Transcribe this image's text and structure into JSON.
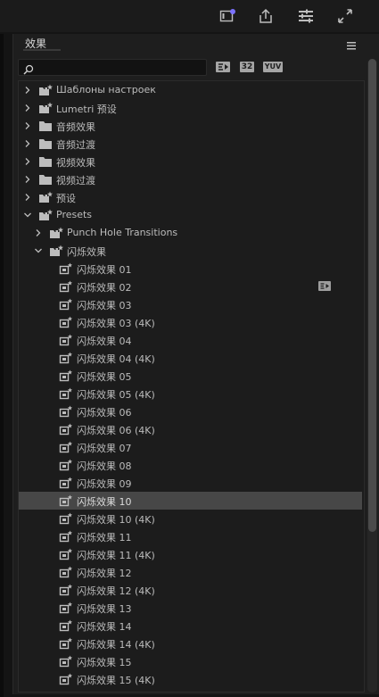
{
  "panel": {
    "title": "效果"
  },
  "search": {
    "value": "",
    "placeholder": ""
  },
  "filters": {
    "b32": "32",
    "yuv": "YUV"
  },
  "tree": [
    {
      "level": 0,
      "expanded": false,
      "icon": "preset-folder-icon",
      "label": "Шаблоны настроек"
    },
    {
      "level": 0,
      "expanded": false,
      "icon": "preset-folder-icon",
      "label": "Lumetri 预设"
    },
    {
      "level": 0,
      "expanded": false,
      "icon": "folder-icon",
      "label": "音频效果"
    },
    {
      "level": 0,
      "expanded": false,
      "icon": "folder-icon",
      "label": "音频过渡"
    },
    {
      "level": 0,
      "expanded": false,
      "icon": "folder-icon",
      "label": "视频效果"
    },
    {
      "level": 0,
      "expanded": false,
      "icon": "folder-icon",
      "label": "视频过渡"
    },
    {
      "level": 0,
      "expanded": false,
      "icon": "preset-folder-icon",
      "label": "预设"
    },
    {
      "level": 0,
      "expanded": true,
      "icon": "preset-folder-icon",
      "label": "Presets"
    },
    {
      "level": 1,
      "expanded": false,
      "icon": "preset-folder-icon",
      "label": "Punch Hole Transitions"
    },
    {
      "level": 1,
      "expanded": true,
      "icon": "preset-folder-icon",
      "label": "闪烁效果"
    },
    {
      "level": 2,
      "icon": "preset-icon",
      "label": "闪烁效果 01"
    },
    {
      "level": 2,
      "icon": "preset-icon",
      "label": "闪烁效果 02",
      "badge": "accelerated-effect-icon"
    },
    {
      "level": 2,
      "icon": "preset-icon",
      "label": "闪烁效果 03"
    },
    {
      "level": 2,
      "icon": "preset-icon",
      "label": "闪烁效果 03 (4K)"
    },
    {
      "level": 2,
      "icon": "preset-icon",
      "label": "闪烁效果 04"
    },
    {
      "level": 2,
      "icon": "preset-icon",
      "label": "闪烁效果 04 (4K)"
    },
    {
      "level": 2,
      "icon": "preset-icon",
      "label": "闪烁效果 05"
    },
    {
      "level": 2,
      "icon": "preset-icon",
      "label": "闪烁效果 05 (4K)"
    },
    {
      "level": 2,
      "icon": "preset-icon",
      "label": "闪烁效果 06"
    },
    {
      "level": 2,
      "icon": "preset-icon",
      "label": "闪烁效果 06 (4K)"
    },
    {
      "level": 2,
      "icon": "preset-icon",
      "label": "闪烁效果 07"
    },
    {
      "level": 2,
      "icon": "preset-icon",
      "label": "闪烁效果 08"
    },
    {
      "level": 2,
      "icon": "preset-icon",
      "label": "闪烁效果 09"
    },
    {
      "level": 2,
      "icon": "preset-icon",
      "label": "闪烁效果 10",
      "selected": true
    },
    {
      "level": 2,
      "icon": "preset-icon",
      "label": "闪烁效果 10 (4K)"
    },
    {
      "level": 2,
      "icon": "preset-icon",
      "label": "闪烁效果 11"
    },
    {
      "level": 2,
      "icon": "preset-icon",
      "label": "闪烁效果 11 (4K)"
    },
    {
      "level": 2,
      "icon": "preset-icon",
      "label": "闪烁效果 12"
    },
    {
      "level": 2,
      "icon": "preset-icon",
      "label": "闪烁效果 12 (4K)"
    },
    {
      "level": 2,
      "icon": "preset-icon",
      "label": "闪烁效果 13"
    },
    {
      "level": 2,
      "icon": "preset-icon",
      "label": "闪烁效果 14"
    },
    {
      "level": 2,
      "icon": "preset-icon",
      "label": "闪烁效果 14 (4K)"
    },
    {
      "level": 2,
      "icon": "preset-icon",
      "label": "闪烁效果 15"
    },
    {
      "level": 2,
      "icon": "preset-icon",
      "label": "闪烁效果 15 (4K)"
    }
  ],
  "colors": {
    "accent_dot": "#7b72ff",
    "selected_row": "#474747"
  }
}
